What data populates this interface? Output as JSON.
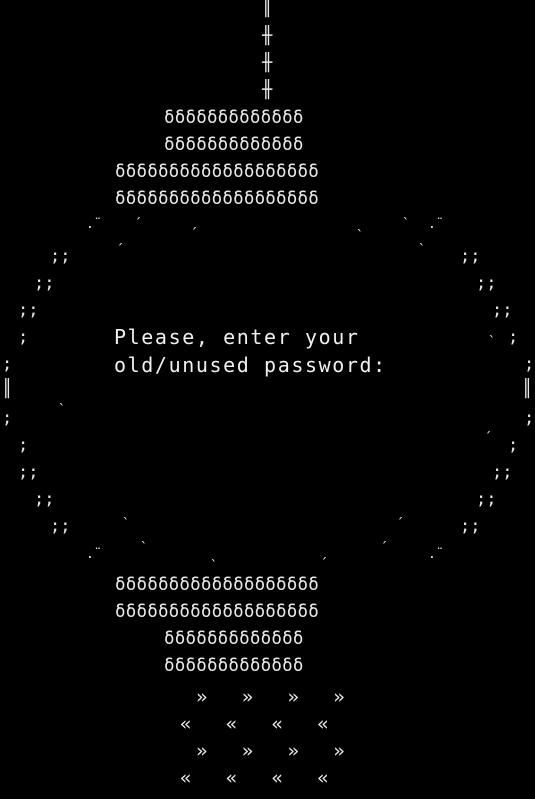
{
  "prompt": {
    "line1": "Please, enter your",
    "line2": "old/unused password:"
  },
  "password": {
    "value": ""
  },
  "art": {
    "chain_bar": "║",
    "chain_link": "╫",
    "bead": "δ",
    "bead_rows": {
      "short": "δδδδδδδδδδδδδ",
      "long": "δδδδδδδδδδδδδδδδδδδ"
    },
    "ring_semicolons": ";;",
    "ring_semicolon": ";",
    "ring_bar": "║",
    "ring_quote_open": "´",
    "ring_quote_close": "`",
    "ring_dots": ".¨",
    "tassel_right": "»   »   »   »",
    "tassel_left": "«   «   «   «"
  },
  "colors": {
    "background": "#000000",
    "foreground": "#e8e8e8"
  }
}
